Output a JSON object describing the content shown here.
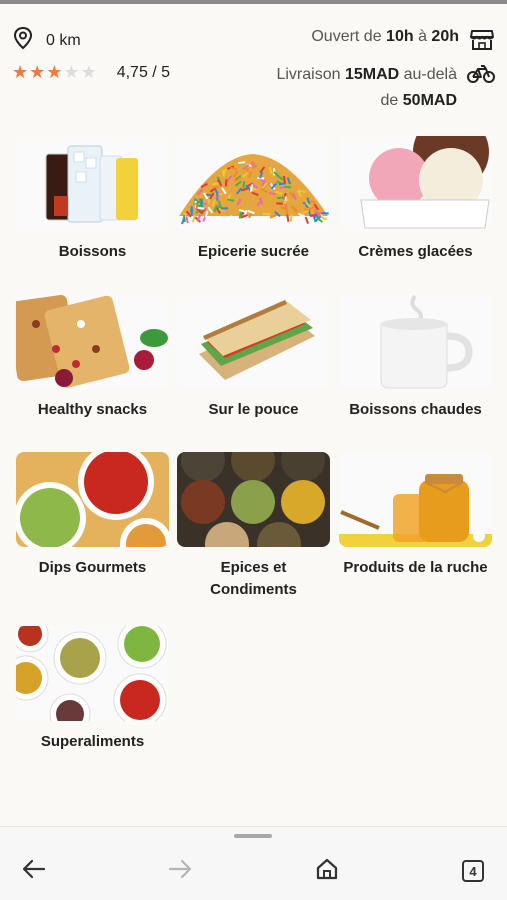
{
  "store": {
    "distance": "0 km",
    "rating": "4,75 / 5",
    "stars_value": 3,
    "stars_max": 5,
    "hours_prefix": "Ouvert de ",
    "hours_open": "10h",
    "hours_mid": " à ",
    "hours_close": "20h",
    "delivery_line1_prefix": "Livraison ",
    "delivery_fee": "15MAD",
    "delivery_line1_suffix": " au-delà",
    "delivery_line2_prefix": "de ",
    "delivery_min": "50MAD"
  },
  "categories": [
    {
      "label": "Boissons",
      "image": "drinks-image"
    },
    {
      "label": "Epicerie sucrée",
      "image": "sprinkles-image"
    },
    {
      "label": "Crèmes glacées",
      "image": "ice-cream-image"
    },
    {
      "label": "Healthy snacks",
      "image": "granola-bars-image"
    },
    {
      "label": "Sur le pouce",
      "image": "sandwich-image"
    },
    {
      "label": "Boissons chaudes",
      "image": "hot-drink-cup-image"
    },
    {
      "label": "Dips Gourmets",
      "image": "dips-image"
    },
    {
      "label": "Epices et Condiments",
      "image": "spice-jars-image"
    },
    {
      "label": "Produits de la ruche",
      "image": "honey-jars-image"
    },
    {
      "label": "Superaliments",
      "image": "superfoods-image"
    }
  ],
  "browser_bar": {
    "tabs_count": "4",
    "icons": [
      "back-arrow-icon",
      "forward-arrow-icon",
      "home-icon",
      "tabs-icon"
    ]
  },
  "colors": {
    "star_filled": "#f07a3c",
    "star_empty": "#dddddd",
    "background": "#fbf9f6"
  }
}
